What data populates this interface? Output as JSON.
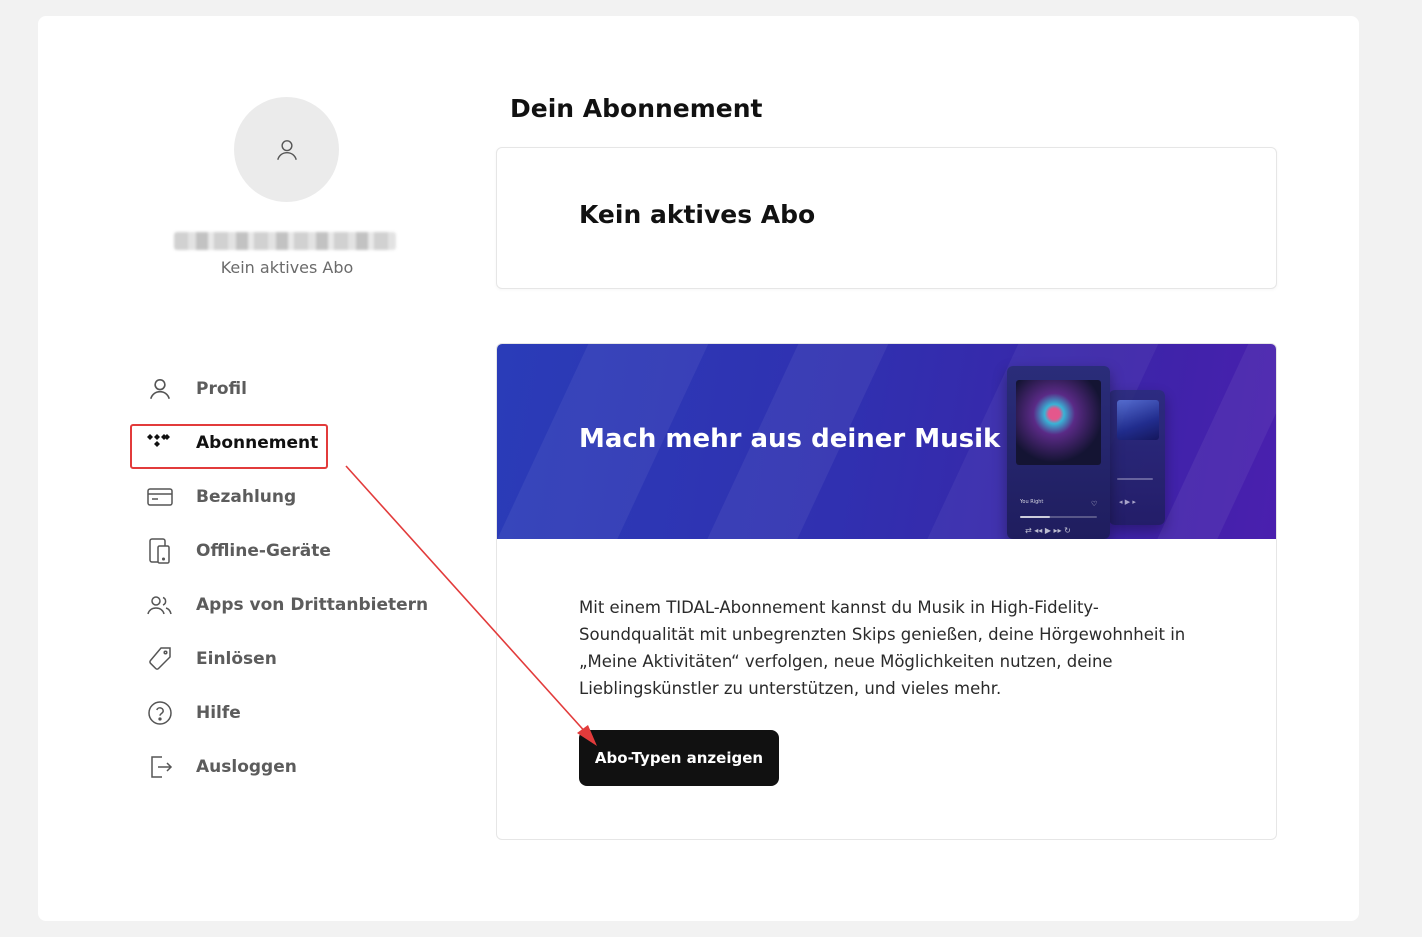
{
  "sidebar": {
    "profile_subtitle": "Kein aktives Abo",
    "items": [
      {
        "label": "Profil",
        "icon": "user-icon"
      },
      {
        "label": "Abonnement",
        "icon": "tidal-logo-icon"
      },
      {
        "label": "Bezahlung",
        "icon": "credit-card-icon"
      },
      {
        "label": "Offline-Geräte",
        "icon": "devices-icon"
      },
      {
        "label": "Apps von Drittanbietern",
        "icon": "users-icon"
      },
      {
        "label": "Einlösen",
        "icon": "tag-icon"
      },
      {
        "label": "Hilfe",
        "icon": "help-circle-icon"
      },
      {
        "label": "Ausloggen",
        "icon": "logout-icon"
      }
    ],
    "active_item": "Abonnement"
  },
  "main": {
    "title": "Dein Abonnement",
    "status": "Kein aktives Abo",
    "promo": {
      "headline": "Mach mehr aus deiner Musik",
      "body": "Mit einem TIDAL-Abonnement kannst du Musik in High-Fidelity-Soundqualität mit unbegrenzten Skips genießen, deine Hörgewohnheit in „Meine Aktivitäten“ verfolgen, neue Möglichkeiten nutzen, deine Lieblingskünstler zu unterstützen, und vieles mehr.",
      "cta_label": "Abo-Typen anzeigen",
      "phone_track": "You Right"
    }
  },
  "colors": {
    "annotation": "#e23b3b",
    "banner_start": "#2a3cb8",
    "banner_end": "#4a1fae",
    "button": "#111111"
  }
}
